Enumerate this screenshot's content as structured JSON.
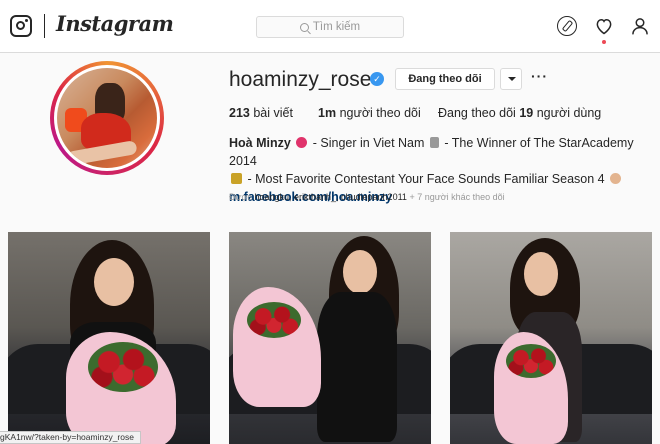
{
  "app": {
    "logo_text": "Instagram"
  },
  "search": {
    "placeholder": "Tìm kiếm"
  },
  "profile": {
    "username": "hoaminzy_rose",
    "follow_label": "Đang theo dõi",
    "more_label": "···",
    "stats": {
      "posts_num": "213",
      "posts_label": "bài viết",
      "followers_num": "1m",
      "followers_label": "người theo dõi",
      "following_prefix": "Đang theo dõi",
      "following_num": "19",
      "following_label": "người dùng"
    },
    "bio": {
      "name": "Hoà Minzy",
      "line1": "- Singer in Viet Nam",
      "line1b": "- The Winner of The StarAcademy 2014",
      "line2": "- Most Favorite Contestant Your Face Sounds Familiar Season 4",
      "link": "m.facebook.com/hoa.minzy"
    },
    "followed_by": {
      "prefix": "Được",
      "users": "hoangku, erikthanh_, chudiepanh2011",
      "suffix": "+ 7 người khác theo dõi"
    }
  },
  "status_bar": {
    "url": "gKA1nw/?taken-by=hoaminzy_rose"
  },
  "icons": [
    "instagram-logo-icon",
    "search-icon",
    "compass-icon",
    "heart-icon",
    "person-icon",
    "verified-badge-icon",
    "chevron-down-icon"
  ],
  "colors": {
    "verified": "#3897f0",
    "link": "#003569",
    "notification": "#ed4956"
  }
}
